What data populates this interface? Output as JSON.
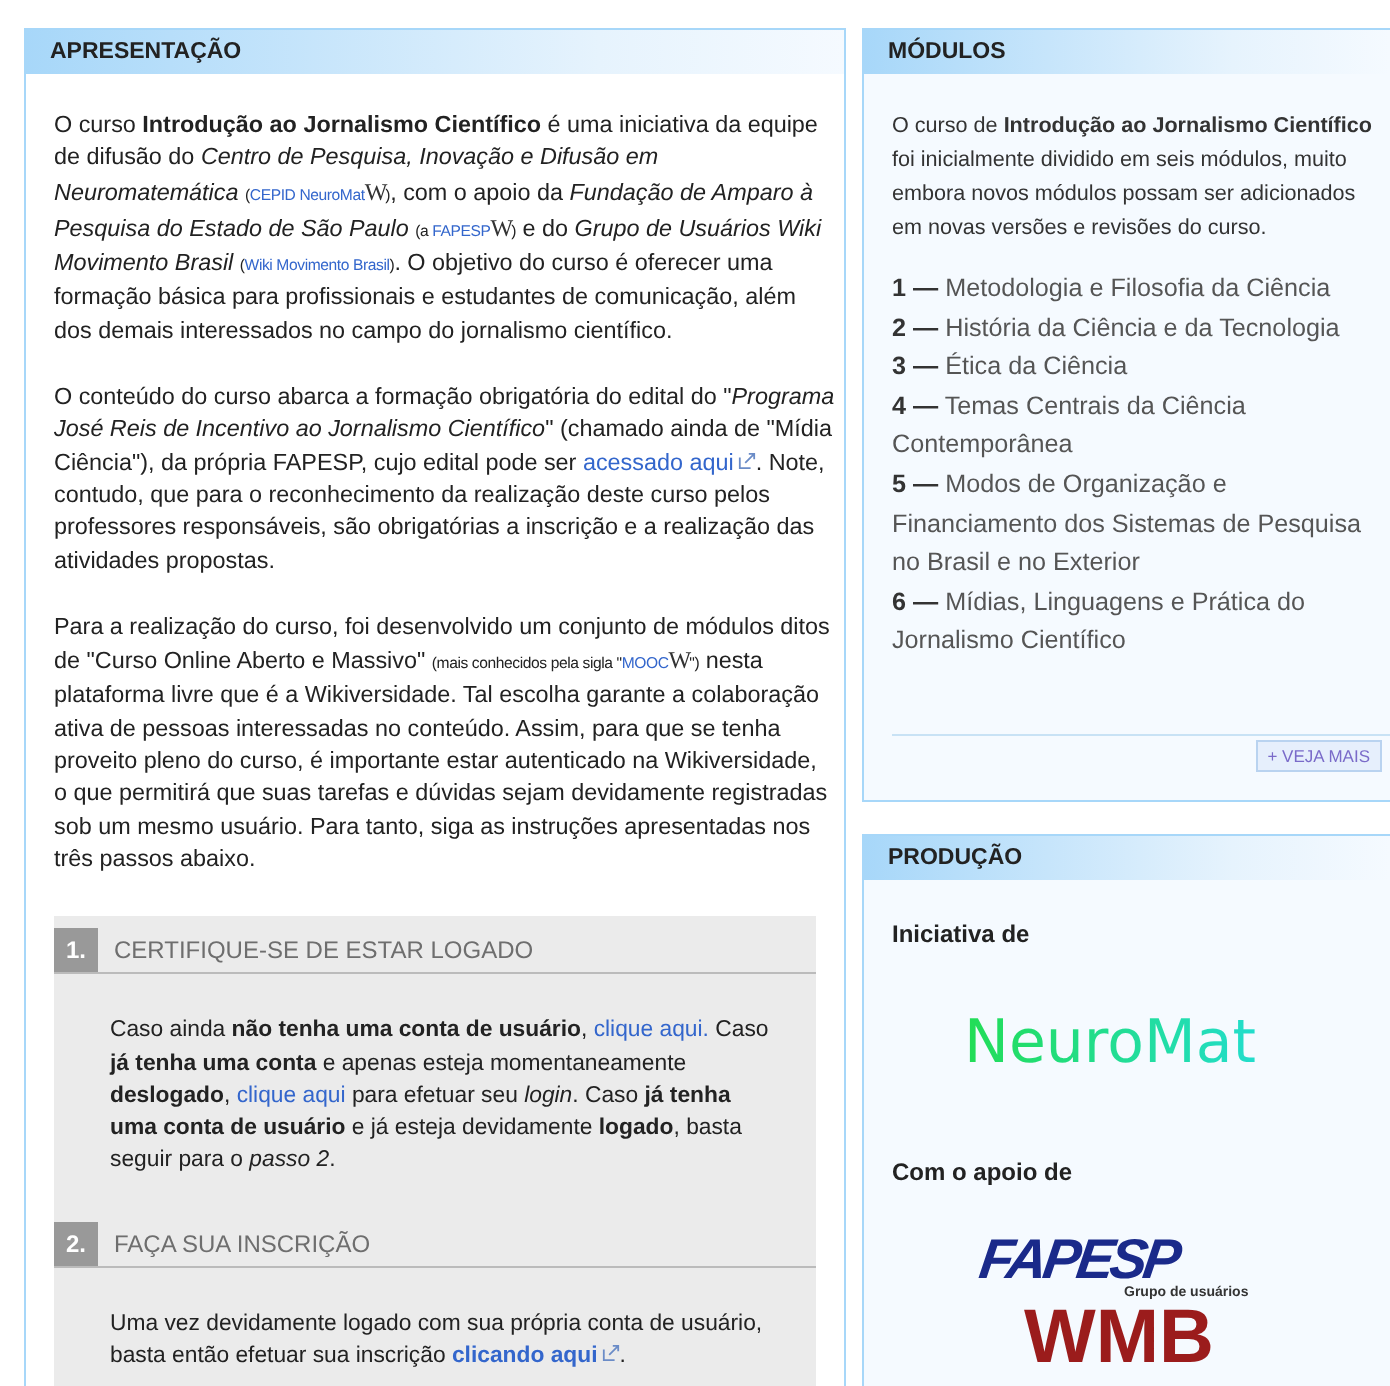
{
  "presentation": {
    "title": "APRESENTAÇÃO",
    "paragraphs": [
      [
        {
          "kind": "text",
          "text": "O curso **Introdução ao Jornalismo Científico** é uma iniciativa da equipe de difusão do *Centro de Pesquisa, Inovação e Difusão em Neuromatemática* "
        },
        {
          "kind": "small",
          "text": "("
        },
        {
          "kind": "small_link",
          "text": "CEPID NeuroMat"
        },
        {
          "kind": "wiki",
          "text": "W"
        },
        {
          "kind": "small",
          "text": ")"
        },
        {
          "kind": "text",
          "text": ", com o apoio da *Fundação de Amparo à Pesquisa do Estado de São Paulo* "
        },
        {
          "kind": "small",
          "text": "(a "
        },
        {
          "kind": "small_link",
          "text": "FAPESP"
        },
        {
          "kind": "wiki",
          "text": "W"
        },
        {
          "kind": "small",
          "text": ")"
        },
        {
          "kind": "text",
          "text": " e do *Grupo de Usuários Wiki Movimento Brasil* "
        },
        {
          "kind": "small",
          "text": "("
        },
        {
          "kind": "small_link",
          "text": "Wiki Movimento Brasil"
        },
        {
          "kind": "small",
          "text": ")"
        },
        {
          "kind": "text",
          "text": ". O objetivo do curso é oferecer uma formação básica para profissionais e estudantes de comunicação, além dos demais interessados no campo do jornalismo científico."
        }
      ],
      [
        {
          "kind": "text",
          "text": "O conteúdo do curso abarca a formação obrigatória do edital do \"*Programa José Reis de Incentivo ao Jornalismo Científico*\" (chamado ainda de \"Mídia Ciência\"), da própria FAPESP, cujo edital pode ser "
        },
        {
          "kind": "link",
          "text": "acessado aqui"
        },
        {
          "kind": "ext"
        },
        {
          "kind": "text",
          "text": ". Note, contudo, que para o reconhecimento da realização deste curso pelos professores responsáveis, são obrigatórias a inscrição e a realização das atividades propostas."
        }
      ],
      [
        {
          "kind": "text",
          "text": "Para a realização do curso, foi desenvolvido um conjunto de módulos ditos de \"Curso Online Aberto e Massivo\" "
        },
        {
          "kind": "small",
          "text": "(mais conhecidos pela sigla \""
        },
        {
          "kind": "small_link",
          "text": "MOOC"
        },
        {
          "kind": "wiki",
          "text": "W"
        },
        {
          "kind": "small",
          "text": "\")"
        },
        {
          "kind": "text",
          "text": " nesta plataforma livre que é a Wikiversidade. Tal escolha garante a colaboração ativa de pessoas interessadas no conteúdo. Assim, para que se tenha proveito pleno do curso, é importante estar autenticado na Wikiversidade, o que permitirá que suas tarefas e dúvidas sejam devidamente registradas sob um mesmo usuário. Para tanto, siga as instruções apresentadas nos três passos abaixo."
        }
      ]
    ],
    "steps": [
      {
        "number": "1.",
        "title": "CERTIFIQUE-SE DE ESTAR LOGADO",
        "body": [
          {
            "kind": "text",
            "text": "Caso ainda **não tenha uma conta de usuário**, "
          },
          {
            "kind": "link",
            "text": "clique aqui."
          },
          {
            "kind": "text",
            "text": " Caso **já tenha uma conta** e apenas esteja momentaneamente **deslogado**, "
          },
          {
            "kind": "link",
            "text": "clique aqui"
          },
          {
            "kind": "text",
            "text": " para efetuar seu *login*. Caso **já tenha uma conta de usuário** e já esteja devidamente **logado**, basta seguir para o *passo 2*."
          }
        ]
      },
      {
        "number": "2.",
        "title": "FAÇA SUA INSCRIÇÃO",
        "body": [
          {
            "kind": "text",
            "text": "Uma vez devidamente logado com sua própria conta de usuário, basta então efetuar sua inscrição "
          },
          {
            "kind": "bold_link",
            "text": "clicando aqui"
          },
          {
            "kind": "ext"
          },
          {
            "kind": "text",
            "text": "."
          }
        ]
      }
    ]
  },
  "modules": {
    "title": "MÓDULOS",
    "intro": "O curso de **Introdução ao Jornalismo Científico** foi inicialmente dividido em seis módulos, muito embora novos módulos possam ser adicionados em novas versões e revisões do curso.",
    "items": [
      {
        "number": "1 —",
        "title": "Metodologia e Filosofia da Ciência"
      },
      {
        "number": "2 —",
        "title": "História da Ciência e da Tecnologia"
      },
      {
        "number": "3 —",
        "title": "Ética da Ciência"
      },
      {
        "number": "4 —",
        "title": "Temas Centrais da Ciência Contemporânea"
      },
      {
        "number": "5 —",
        "title": "Modos de Organização e Financiamento dos Sistemas de Pesquisa no Brasil e no Exterior"
      },
      {
        "number": "6 —",
        "title": "Mídias, Linguagens e Prática do Jornalismo Científico"
      }
    ],
    "more_button": "+ VEJA MAIS"
  },
  "production": {
    "title": "PRODUÇÃO",
    "initiative_label": "Iniciativa de",
    "initiative_logo": "NeuroMat",
    "support_label": "Com o apoio de",
    "support_logos": [
      {
        "kind": "fapesp",
        "text": "FAPESP"
      },
      {
        "kind": "wmb",
        "caption": "Grupo de usuários",
        "text": "WMB"
      }
    ]
  }
}
